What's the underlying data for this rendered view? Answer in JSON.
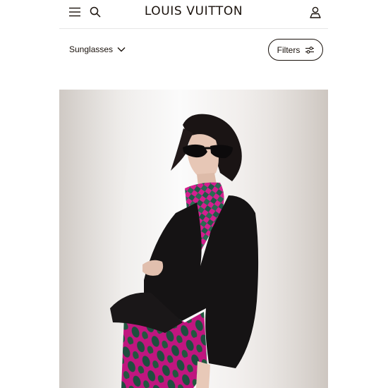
{
  "header": {
    "brand": "LOUIS VUITTON",
    "icons": {
      "menu": "menu-icon",
      "search": "search-icon",
      "account": "account-icon"
    }
  },
  "toolbar": {
    "category_label": "Sunglasses",
    "filters_label": "Filters"
  },
  "hero": {
    "image": "campaign-photo-woman-sunglasses",
    "accent_colors": {
      "jacket": "#141214",
      "scarf_pink": "#d41f8f",
      "scarf_green": "#1f5b47"
    }
  }
}
